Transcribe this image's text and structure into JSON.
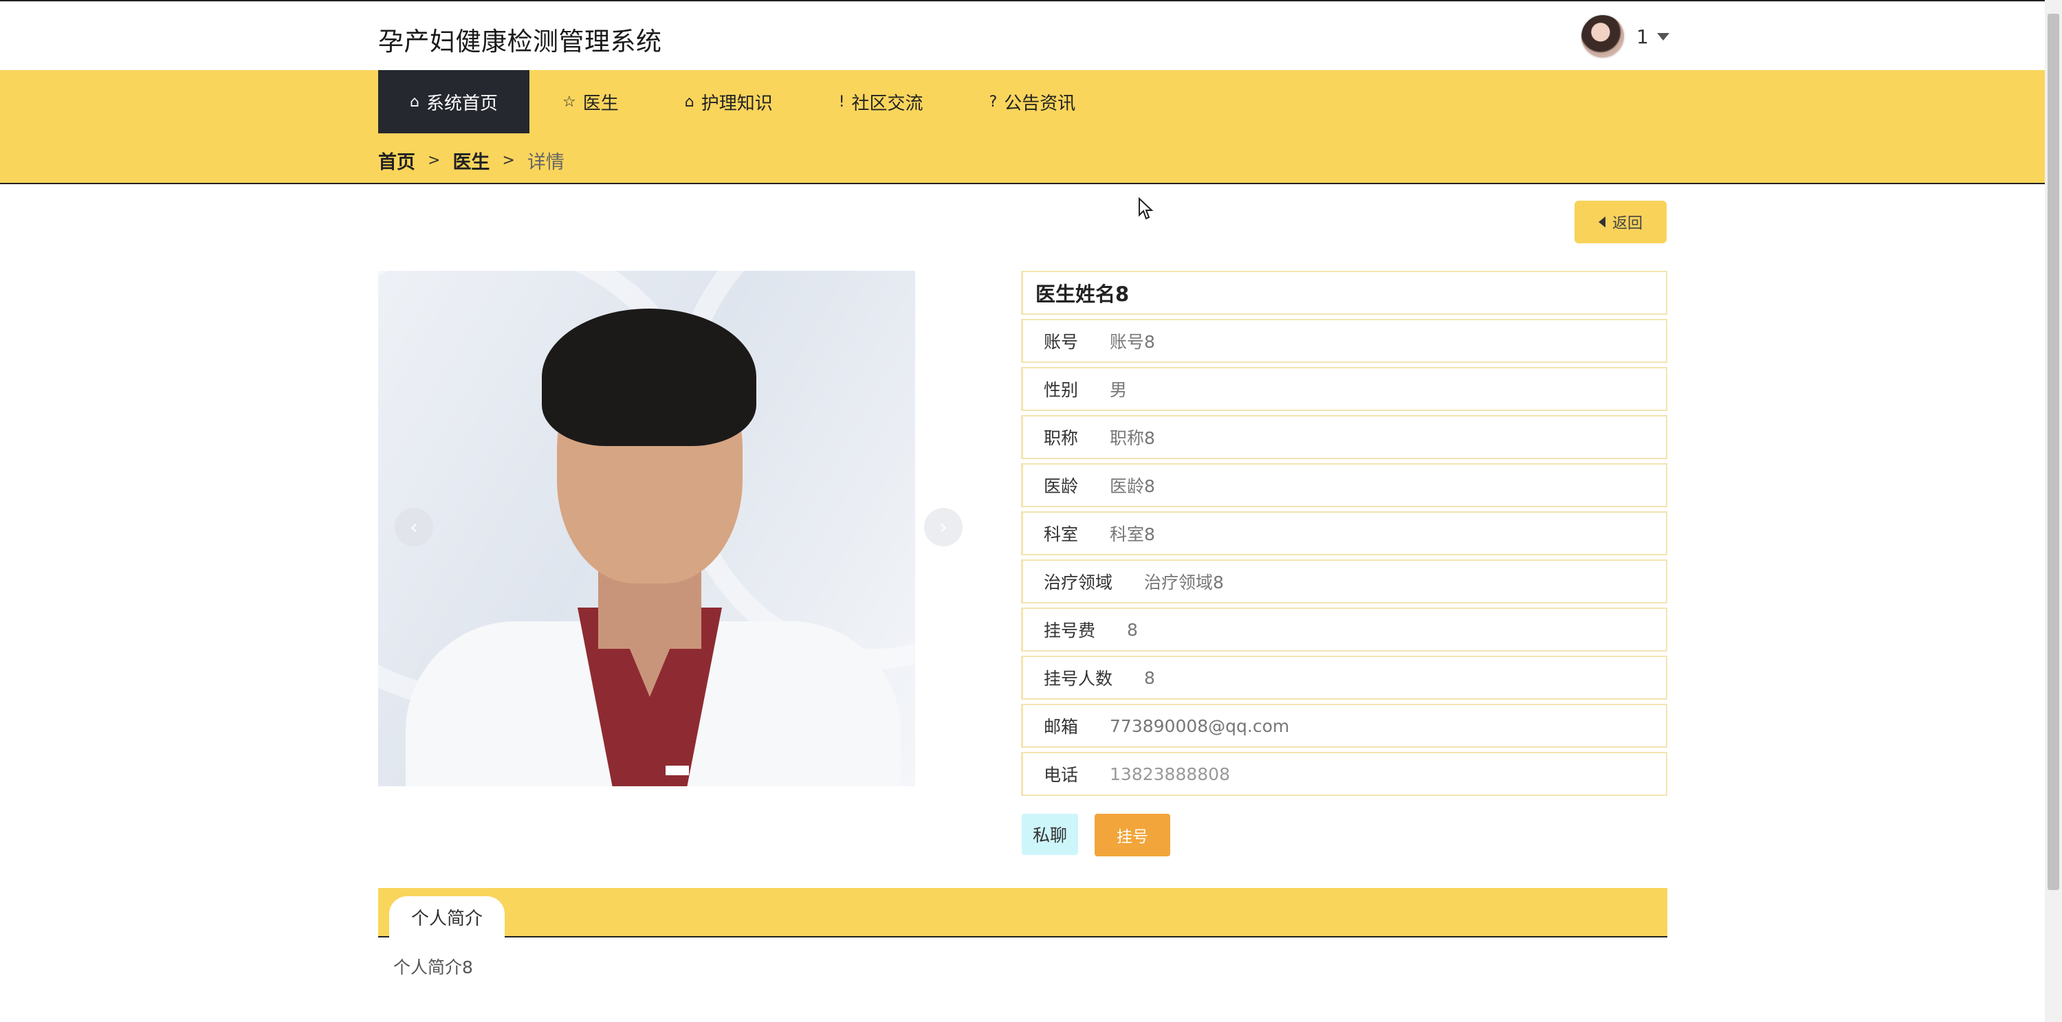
{
  "header": {
    "site_title": "孕产妇健康检测管理系统",
    "user": {
      "name": "1",
      "avatar_icon": "user-avatar",
      "dropdown_icon": "caret-down-icon"
    }
  },
  "nav": {
    "items": [
      {
        "label": "系统首页",
        "icon": "home-icon",
        "glyph": "⌂",
        "active": true
      },
      {
        "label": "医生",
        "icon": "star-icon",
        "glyph": "☆",
        "active": false
      },
      {
        "label": "护理知识",
        "icon": "lock-icon",
        "glyph": "⌂",
        "active": false
      },
      {
        "label": "社区交流",
        "icon": "exclamation-circle-icon",
        "glyph": "!",
        "active": false
      },
      {
        "label": "公告资讯",
        "icon": "question-circle-icon",
        "glyph": "?",
        "active": false
      }
    ]
  },
  "breadcrumb": {
    "home": "首页",
    "sep": ">",
    "section": "医生",
    "current": "详情"
  },
  "back_button": {
    "label": "返回",
    "icon": "caret-left-icon"
  },
  "carousel": {
    "prev_glyph": "‹",
    "next_glyph": "›"
  },
  "doctor": {
    "name": "医生姓名8",
    "fields": [
      {
        "label": "账号",
        "value": "账号8"
      },
      {
        "label": "性别",
        "value": "男"
      },
      {
        "label": "职称",
        "value": "职称8"
      },
      {
        "label": "医龄",
        "value": "医龄8"
      },
      {
        "label": "科室",
        "value": "科室8"
      },
      {
        "label": "治疗领域",
        "value": "治疗领域8"
      },
      {
        "label": "挂号费",
        "value": "8"
      },
      {
        "label": "挂号人数",
        "value": "8"
      },
      {
        "label": "邮箱",
        "value": "773890008@qq.com"
      },
      {
        "label": "电话",
        "value": "13823888808"
      }
    ]
  },
  "actions": {
    "chat": "私聊",
    "register": "挂号"
  },
  "tabs": {
    "intro_label": "个人简介",
    "intro_content": "个人简介8"
  },
  "colors": {
    "accent": "#fad55c",
    "nav_active": "#25282f",
    "register": "#f2a53a",
    "chat": "#cdf6fb"
  }
}
